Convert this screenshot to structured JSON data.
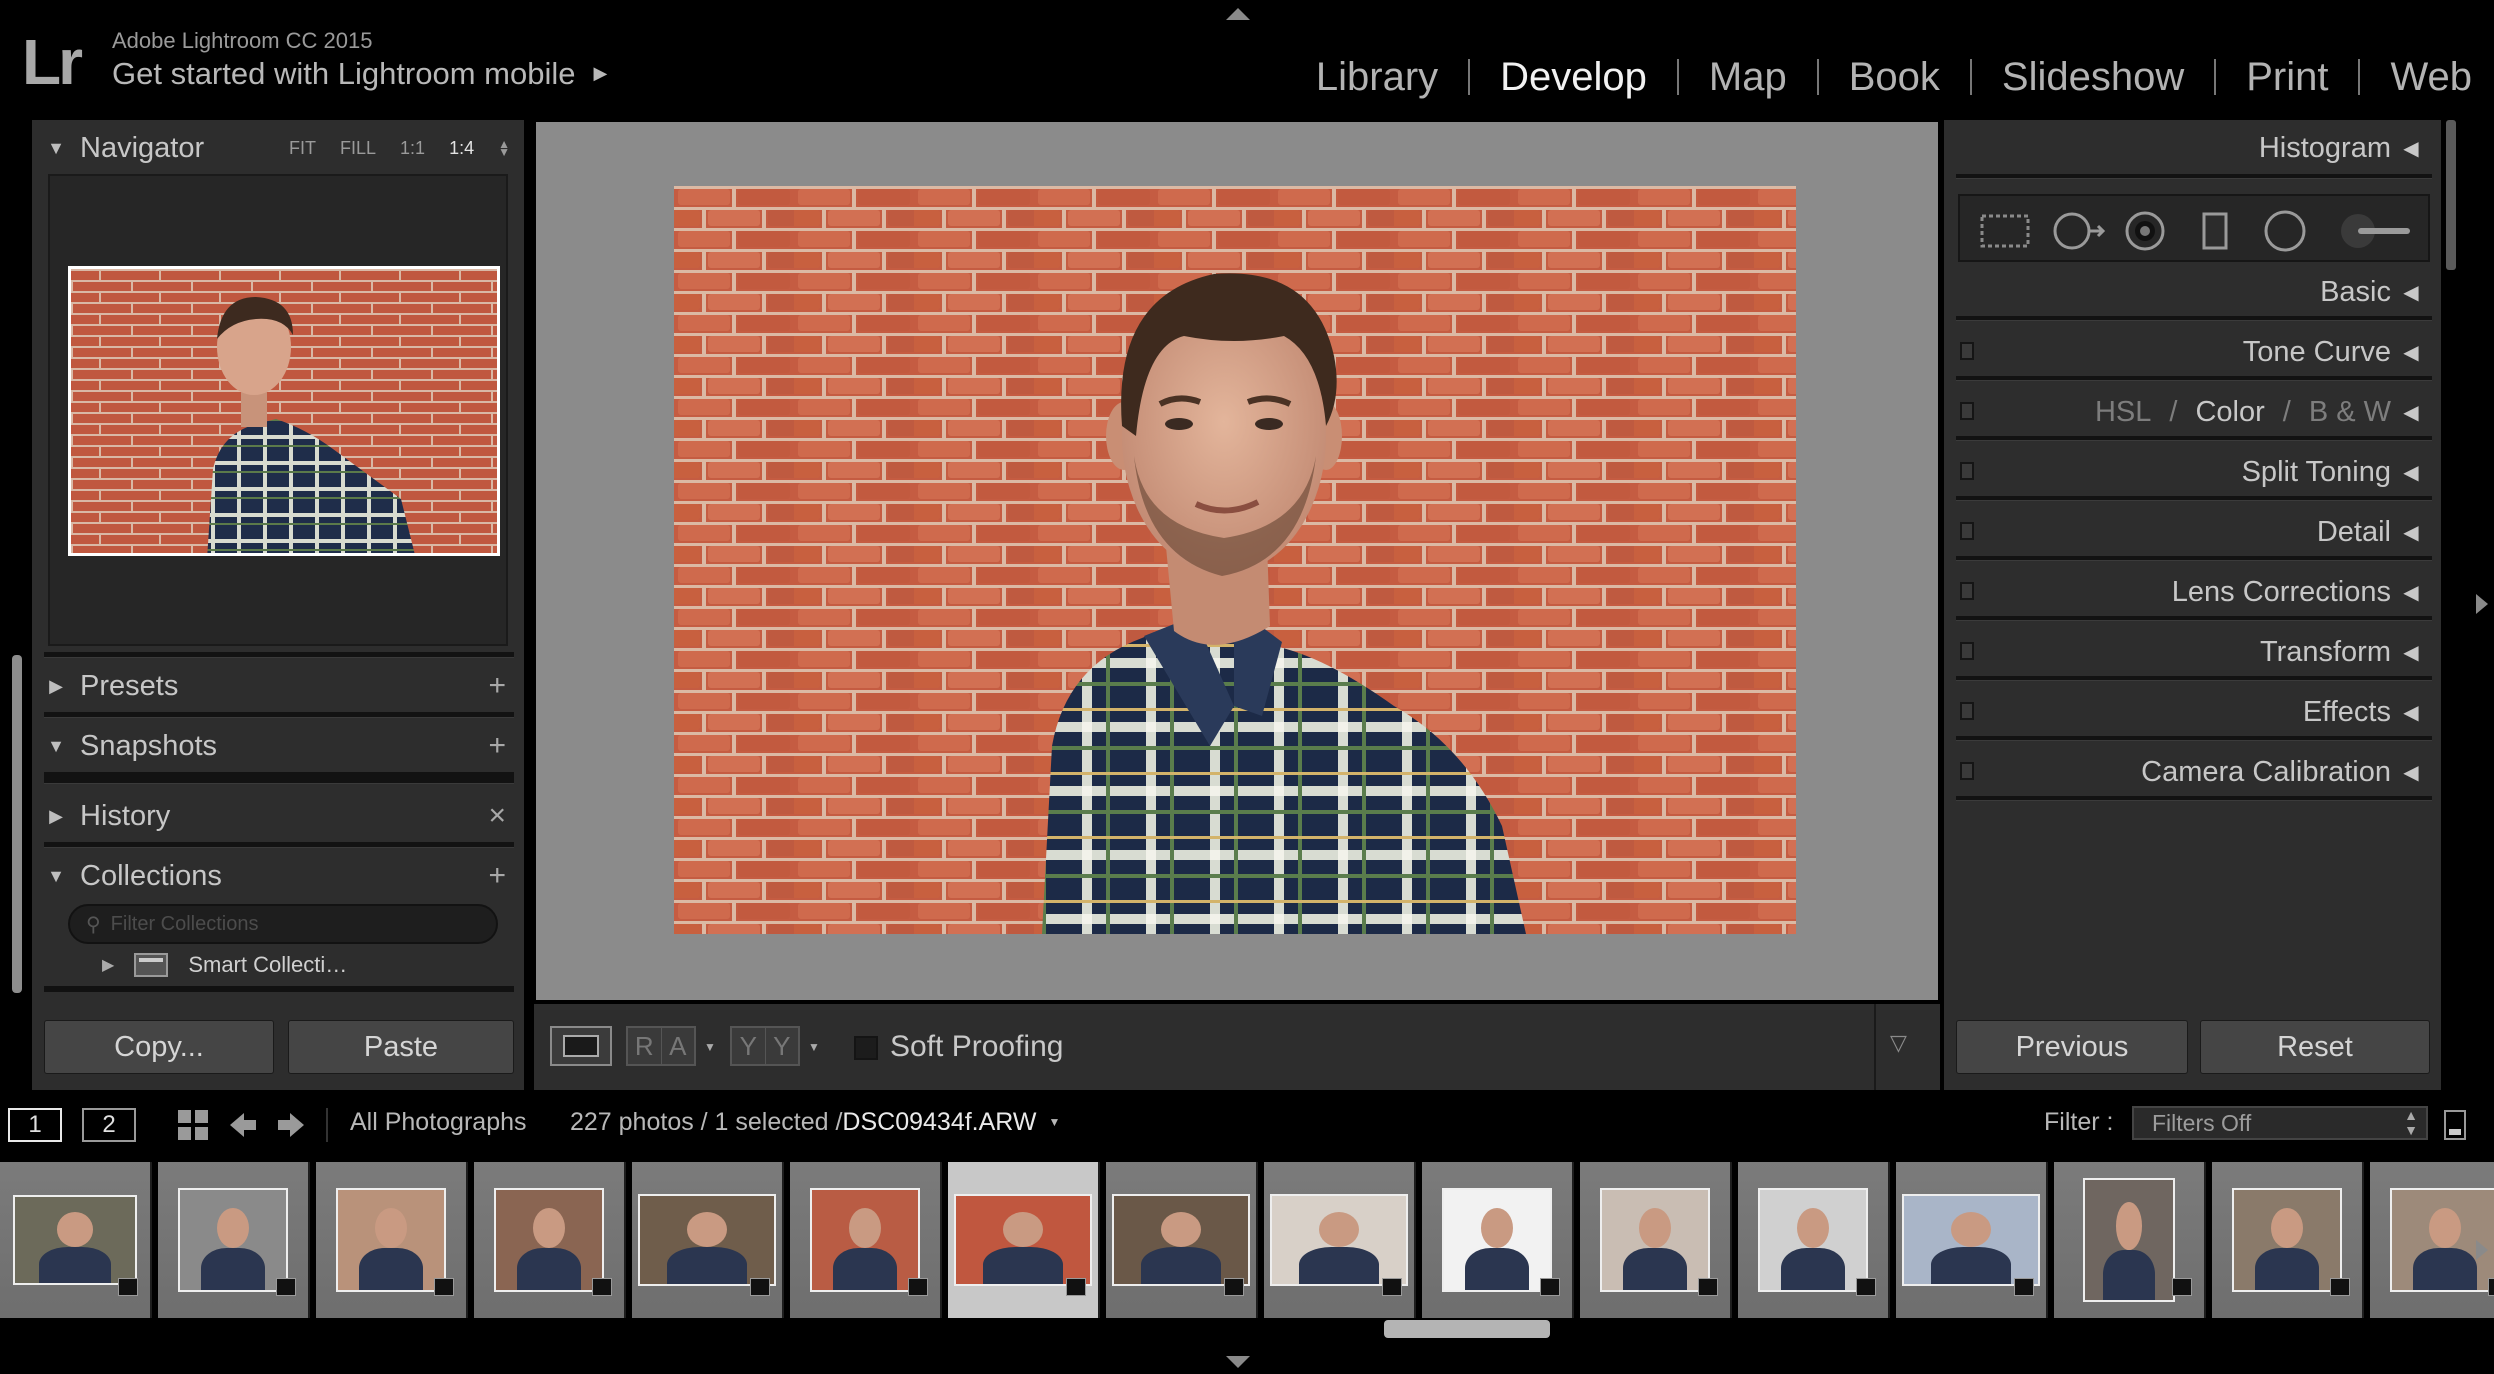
{
  "identity": {
    "logo": "Lr",
    "app_title": "Adobe Lightroom CC 2015",
    "mobile_link": "Get started with Lightroom mobile"
  },
  "modules": [
    "Library",
    "Develop",
    "Map",
    "Book",
    "Slideshow",
    "Print",
    "Web"
  ],
  "active_module": "Develop",
  "left_panel": {
    "navigator": {
      "title": "Navigator",
      "zoom_options": [
        "FIT",
        "FILL",
        "1:1",
        "1:4"
      ],
      "zoom_selected": "1:4"
    },
    "presets": {
      "title": "Presets",
      "action": "+"
    },
    "snapshots": {
      "title": "Snapshots",
      "action": "+"
    },
    "history": {
      "title": "History",
      "action": "×"
    },
    "collections": {
      "title": "Collections",
      "action": "+",
      "filter_placeholder": "Filter Collections",
      "items": [
        {
          "label": "Smart Collecti…"
        }
      ]
    },
    "copy_button": "Copy...",
    "paste_button": "Paste"
  },
  "right_panel": {
    "histogram": "Histogram",
    "tool_icons": [
      "crop-overlay-icon",
      "spot-removal-icon",
      "red-eye-icon",
      "graduated-filter-icon",
      "radial-filter-icon",
      "adjustment-brush-icon"
    ],
    "sections": {
      "basic": "Basic",
      "tone_curve": "Tone Curve",
      "hsl": "HSL",
      "color": "Color",
      "bw": "B & W",
      "split_toning": "Split Toning",
      "detail": "Detail",
      "lens_corrections": "Lens Corrections",
      "transform": "Transform",
      "effects": "Effects",
      "camera_calibration": "Camera Calibration"
    },
    "previous_button": "Previous",
    "reset_button": "Reset"
  },
  "toolbar": {
    "soft_proofing": "Soft Proofing",
    "before_after_labels": [
      "R",
      "A",
      "Y",
      "Y"
    ]
  },
  "filmstrip_bar": {
    "views": [
      "1",
      "2"
    ],
    "source": "All Photographs",
    "count": "227 photos / 1 selected /",
    "filename": "DSC09434f.ARW",
    "filter_label": "Filter :",
    "filter_value": "Filters Off"
  },
  "filmstrip": {
    "selected_index": 6,
    "thumbs": [
      {
        "bg": "#6c6a5a",
        "w": 124,
        "h": 90
      },
      {
        "bg": "#8a8a8a",
        "w": 110,
        "h": 104
      },
      {
        "bg": "#b9927a",
        "w": 110,
        "h": 104
      },
      {
        "bg": "#8a6552",
        "w": 110,
        "h": 104
      },
      {
        "bg": "#6f5d4b",
        "w": 138,
        "h": 92
      },
      {
        "bg": "#b95c44",
        "w": 110,
        "h": 104
      },
      {
        "bg": "#c0573f",
        "w": 138,
        "h": 92
      },
      {
        "bg": "#6a5848",
        "w": 138,
        "h": 92
      },
      {
        "bg": "#d8d0c8",
        "w": 138,
        "h": 92
      },
      {
        "bg": "#f2f2f2",
        "w": 110,
        "h": 104
      },
      {
        "bg": "#c9bdb3",
        "w": 110,
        "h": 104
      },
      {
        "bg": "#d0d0d0",
        "w": 110,
        "h": 104
      },
      {
        "bg": "#a9b5c8",
        "w": 138,
        "h": 92
      },
      {
        "bg": "#6f6660",
        "w": 92,
        "h": 124
      },
      {
        "bg": "#8a7a6a",
        "w": 110,
        "h": 104
      },
      {
        "bg": "#9d8a7a",
        "w": 110,
        "h": 104
      }
    ]
  }
}
